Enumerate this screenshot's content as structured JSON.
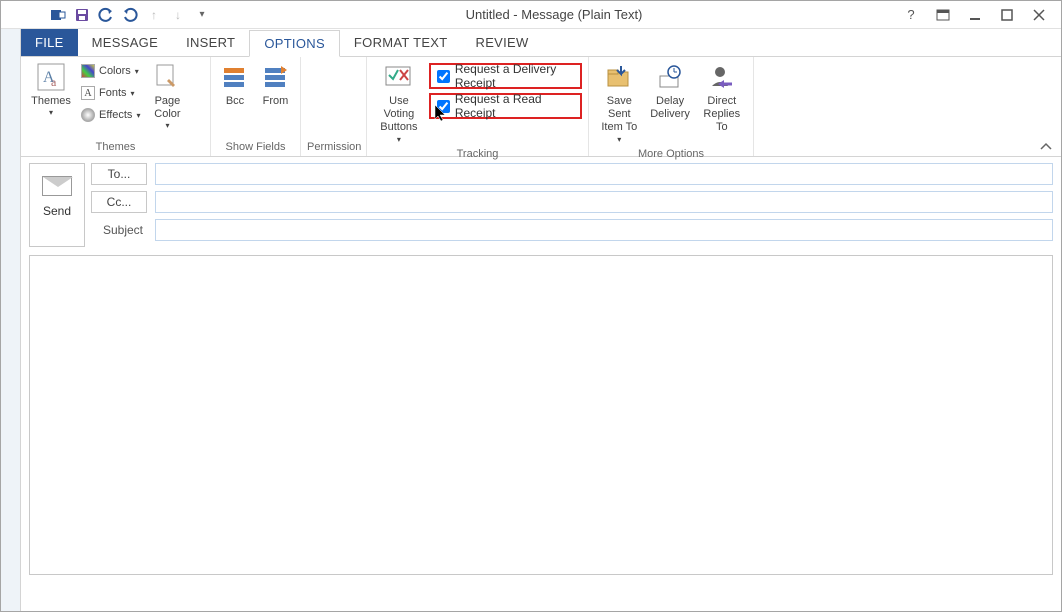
{
  "title": "Untitled - Message (Plain Text)",
  "qat": {
    "dropdown": "▾"
  },
  "tabs": {
    "file": "FILE",
    "message": "MESSAGE",
    "insert": "INSERT",
    "options": "OPTIONS",
    "format_text": "FORMAT TEXT",
    "review": "REVIEW"
  },
  "ribbon": {
    "themes": {
      "label": "Themes",
      "themes_btn": "Themes",
      "colors": "Colors",
      "fonts": "Fonts",
      "effects": "Effects",
      "page_color": "Page\nColor"
    },
    "show_fields": {
      "label": "Show Fields",
      "bcc": "Bcc",
      "from": "From"
    },
    "permission": {
      "label": "Permission"
    },
    "tracking": {
      "label": "Tracking",
      "voting": "Use Voting\nButtons",
      "delivery": "Request a Delivery Receipt",
      "read": "Request a Read Receipt"
    },
    "more_options": {
      "label": "More Options",
      "save_sent": "Save Sent\nItem To",
      "delay": "Delay\nDelivery",
      "direct": "Direct\nReplies To"
    }
  },
  "compose": {
    "send": "Send",
    "to": "To...",
    "cc": "Cc...",
    "subject_label": "Subject",
    "to_value": "",
    "cc_value": "",
    "subject_value": "",
    "body_value": ""
  }
}
